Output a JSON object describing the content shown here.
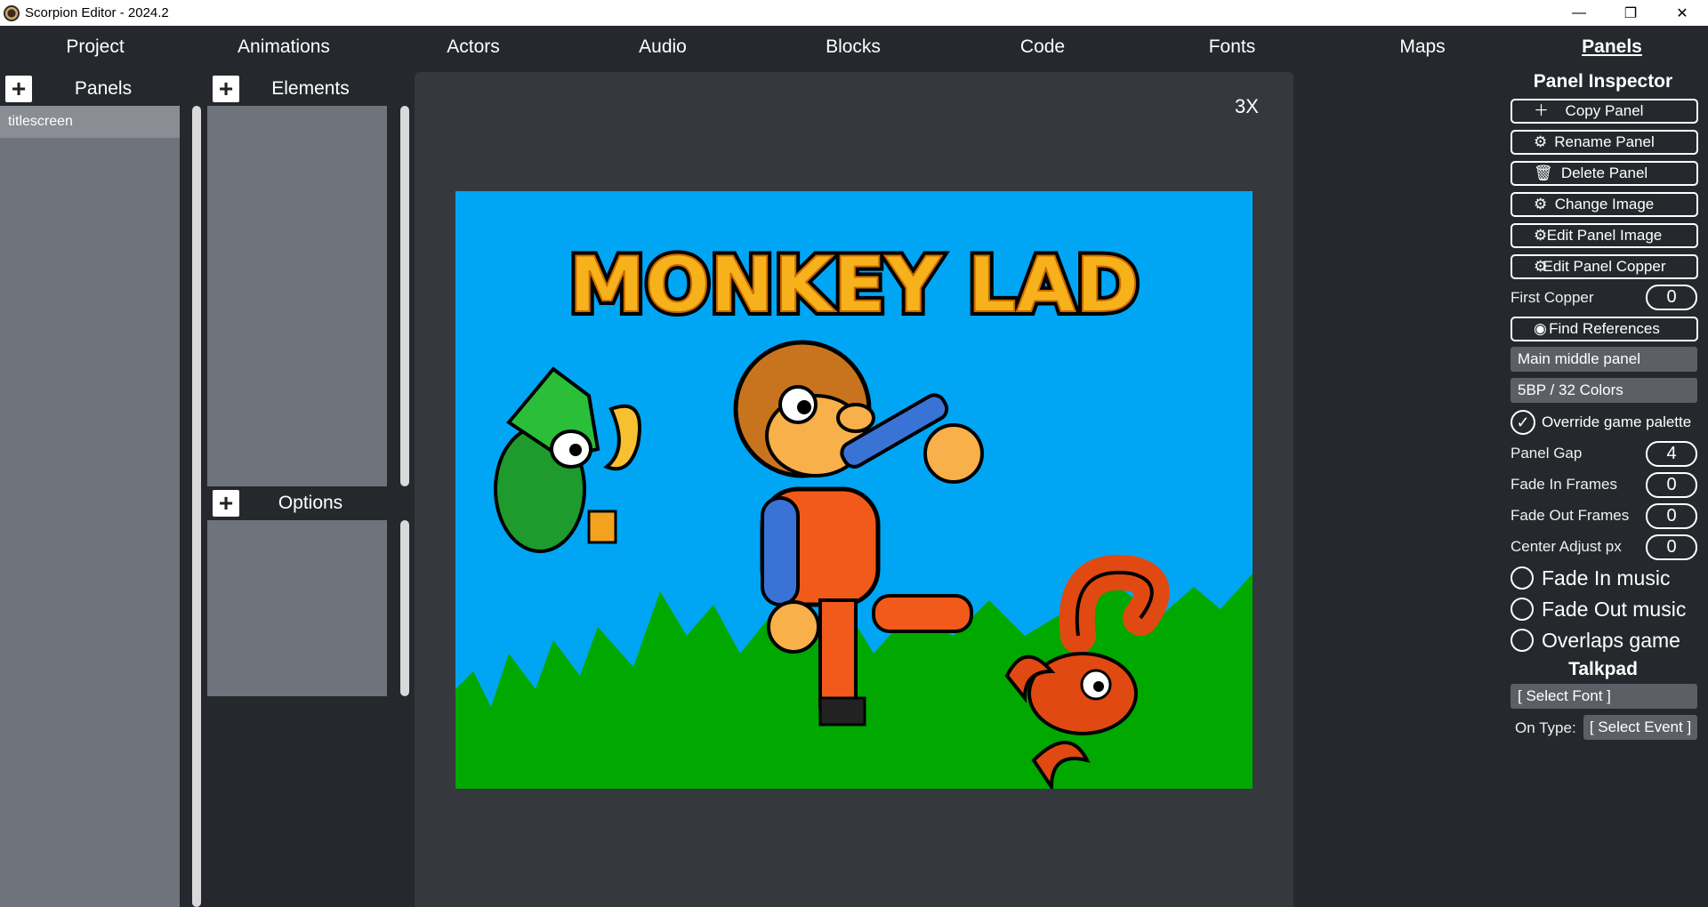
{
  "window": {
    "title": "Scorpion Editor - 2024.2",
    "min": "—",
    "restore": "❐",
    "close": "✕"
  },
  "menu": [
    "Project",
    "Animations",
    "Actors",
    "Audio",
    "Blocks",
    "Code",
    "Fonts",
    "Maps",
    "Panels"
  ],
  "active_menu": "Panels",
  "panels_list": {
    "title": "Panels",
    "add": "+",
    "items": [
      "titlescreen"
    ]
  },
  "elements": {
    "title": "Elements",
    "add": "+"
  },
  "options": {
    "title": "Options",
    "add": "+"
  },
  "preview": {
    "zoom": "3X",
    "game_title": "MONKEY LAD"
  },
  "inspector": {
    "title": "Panel Inspector",
    "copy_panel": "Copy Panel",
    "rename_panel": "Rename Panel",
    "delete_panel": "Delete Panel",
    "change_image": "Change Image",
    "edit_panel_image": "Edit Panel Image",
    "edit_panel_copper": "Edit Panel Copper",
    "first_copper_label": "First Copper",
    "first_copper_value": "0",
    "find_references": "Find References",
    "panel_type": "Main middle panel",
    "color_mode": "5BP / 32 Colors",
    "override_palette": "Override game palette",
    "panel_gap_label": "Panel Gap",
    "panel_gap_value": "4",
    "fade_in_label": "Fade In Frames",
    "fade_in_value": "0",
    "fade_out_label": "Fade Out Frames",
    "fade_out_value": "0",
    "center_adjust_label": "Center Adjust px",
    "center_adjust_value": "0",
    "fade_in_music": "Fade In music",
    "fade_out_music": "Fade Out music",
    "overlaps_game": "Overlaps game",
    "talkpad_title": "Talkpad",
    "select_font": "[ Select Font ]",
    "on_type_label": "On Type:",
    "select_event": "[ Select Event ]"
  },
  "colors": {
    "sky": "#00a6f4",
    "grass": "#00a800",
    "title_gold": "#f7b21b"
  }
}
